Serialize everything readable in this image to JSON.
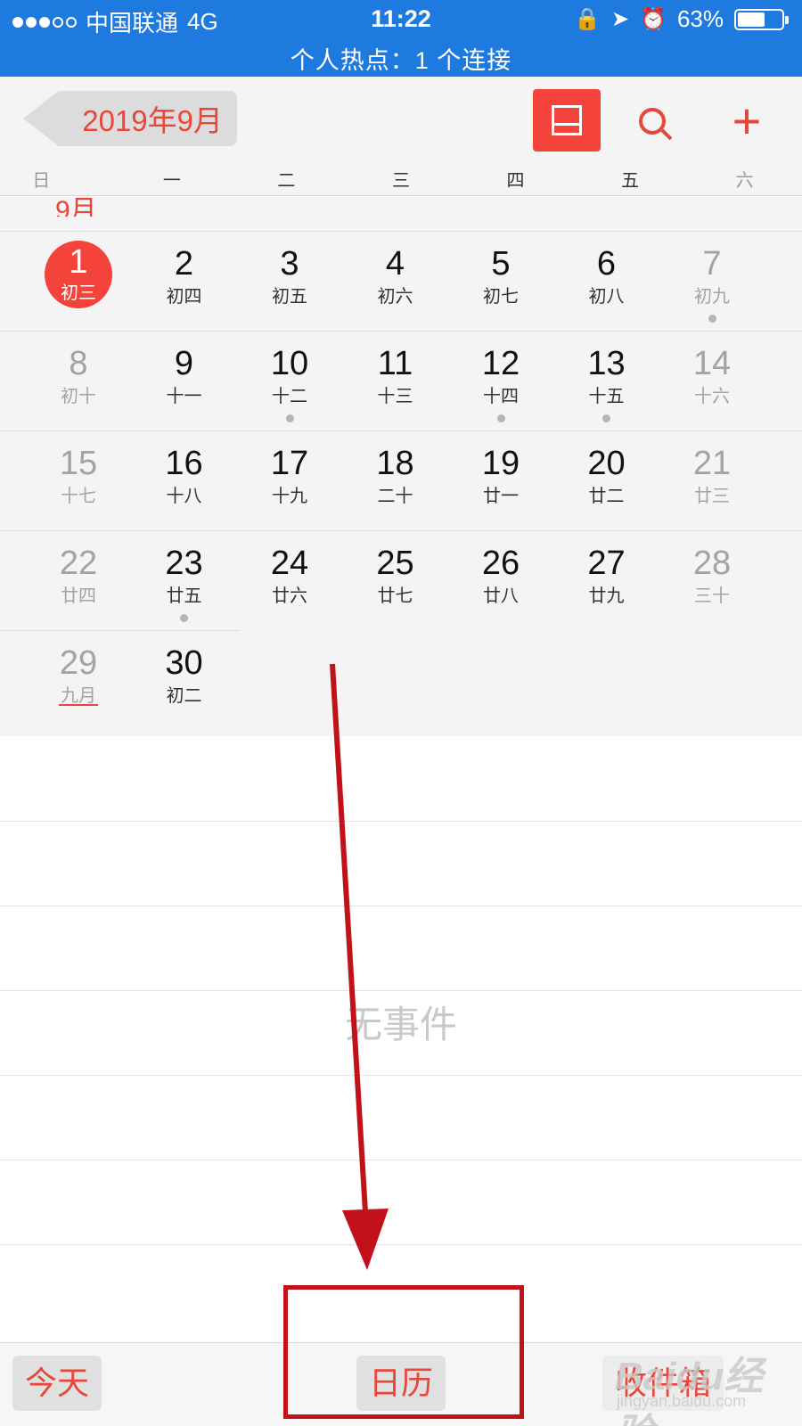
{
  "status_bar": {
    "carrier": "中国联通",
    "network": "4G",
    "time": "11:22",
    "battery": "63%",
    "battery_level": 0.63,
    "hotspot": "个人热点：1 个连接"
  },
  "nav": {
    "back_label": "2019年9月",
    "icons": [
      "list-view-icon",
      "search-icon",
      "add-icon"
    ],
    "add_symbol": "+"
  },
  "weekdays": [
    "日",
    "一",
    "二",
    "三",
    "四",
    "五",
    "六"
  ],
  "month_label": "9月",
  "weeks": [
    [
      {
        "day": "1",
        "lunar": "初三",
        "today": true
      },
      {
        "day": "2",
        "lunar": "初四"
      },
      {
        "day": "3",
        "lunar": "初五"
      },
      {
        "day": "4",
        "lunar": "初六"
      },
      {
        "day": "5",
        "lunar": "初七"
      },
      {
        "day": "6",
        "lunar": "初八"
      },
      {
        "day": "7",
        "lunar": "初九",
        "dot": true
      }
    ],
    [
      {
        "day": "8",
        "lunar": "初十"
      },
      {
        "day": "9",
        "lunar": "十一"
      },
      {
        "day": "10",
        "lunar": "十二",
        "dot": true
      },
      {
        "day": "11",
        "lunar": "十三"
      },
      {
        "day": "12",
        "lunar": "十四",
        "dot": true
      },
      {
        "day": "13",
        "lunar": "十五",
        "dot": true
      },
      {
        "day": "14",
        "lunar": "十六"
      }
    ],
    [
      {
        "day": "15",
        "lunar": "十七"
      },
      {
        "day": "16",
        "lunar": "十八"
      },
      {
        "day": "17",
        "lunar": "十九"
      },
      {
        "day": "18",
        "lunar": "二十"
      },
      {
        "day": "19",
        "lunar": "廿一"
      },
      {
        "day": "20",
        "lunar": "廿二"
      },
      {
        "day": "21",
        "lunar": "廿三"
      }
    ],
    [
      {
        "day": "22",
        "lunar": "廿四"
      },
      {
        "day": "23",
        "lunar": "廿五",
        "dot": true
      },
      {
        "day": "24",
        "lunar": "廿六"
      },
      {
        "day": "25",
        "lunar": "廿七"
      },
      {
        "day": "26",
        "lunar": "廿八"
      },
      {
        "day": "27",
        "lunar": "廿九"
      },
      {
        "day": "28",
        "lunar": "三十"
      }
    ],
    [
      {
        "day": "29",
        "lunar": "九月",
        "underline": true
      },
      {
        "day": "30",
        "lunar": "初二"
      }
    ]
  ],
  "events": {
    "empty_text": "无事件"
  },
  "toolbar": {
    "today_label": "今天",
    "calendars_label": "日历",
    "inbox_label": "收件箱"
  },
  "watermark": {
    "brand": "Baidu经验",
    "url": "jingyan.baidu.com"
  },
  "colors": {
    "status_bar": "#1f7ae0",
    "accent_red": "#f4433a",
    "annotation": "#c1121b"
  }
}
